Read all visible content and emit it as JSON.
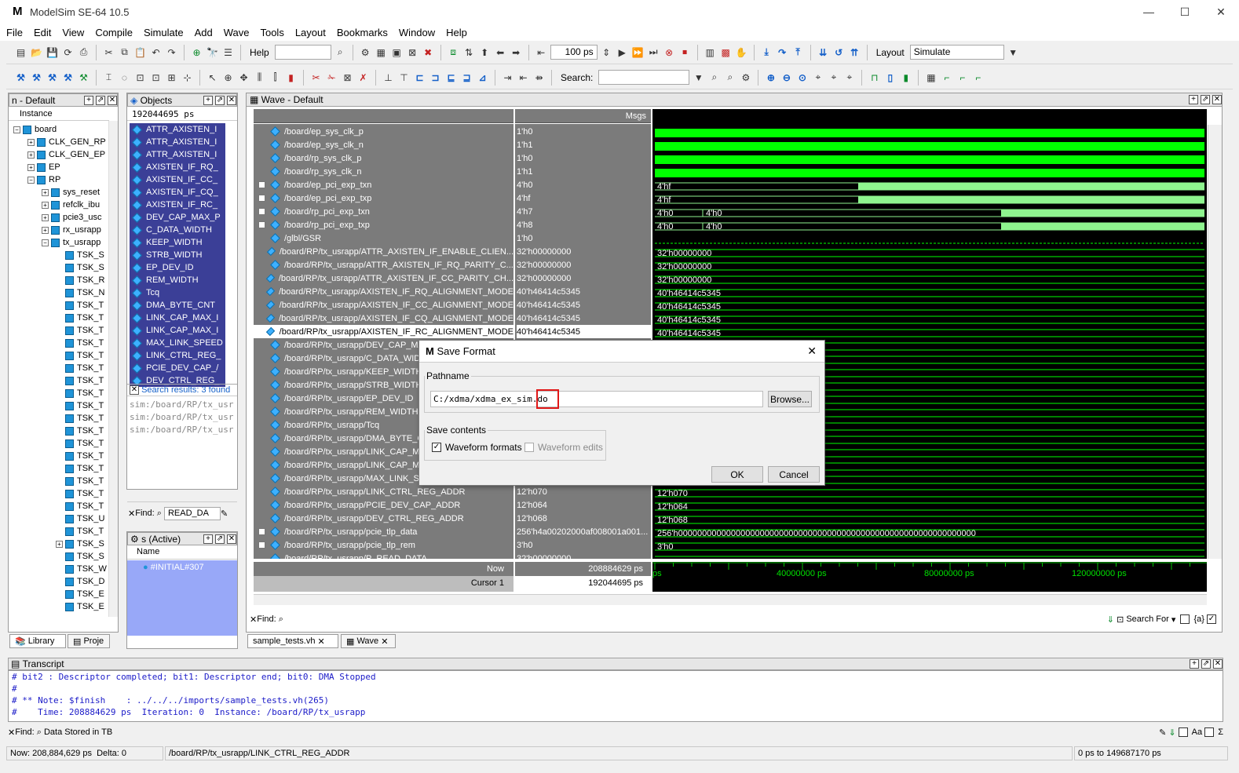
{
  "app": {
    "title": "ModelSim SE-64 10.5"
  },
  "menu": [
    "File",
    "Edit",
    "View",
    "Compile",
    "Simulate",
    "Add",
    "Wave",
    "Tools",
    "Layout",
    "Bookmarks",
    "Window",
    "Help"
  ],
  "toolbar1": {
    "help_label": "Help",
    "time_value": "100 ps",
    "layout_label": "Layout",
    "layout_value": "Simulate"
  },
  "toolbar2": {
    "search_label": "Search:"
  },
  "instance_panel": {
    "title": "n - Default",
    "column": "Instance",
    "rows": [
      {
        "label": "board",
        "level": 0,
        "exp": "-"
      },
      {
        "label": "CLK_GEN_RP",
        "level": 1,
        "exp": "+"
      },
      {
        "label": "CLK_GEN_EP",
        "level": 1,
        "exp": "+"
      },
      {
        "label": "EP",
        "level": 1,
        "exp": "+"
      },
      {
        "label": "RP",
        "level": 1,
        "exp": "-"
      },
      {
        "label": "sys_reset",
        "level": 2,
        "exp": "+"
      },
      {
        "label": "refclk_ibu",
        "level": 2,
        "exp": "+"
      },
      {
        "label": "pcie3_usc",
        "level": 2,
        "exp": "+"
      },
      {
        "label": "rx_usrapp",
        "level": 2,
        "exp": "+"
      },
      {
        "label": "tx_usrapp",
        "level": 2,
        "exp": "-"
      },
      {
        "label": "TSK_S",
        "level": 3,
        "exp": ""
      },
      {
        "label": "TSK_S",
        "level": 3,
        "exp": ""
      },
      {
        "label": "TSK_R",
        "level": 3,
        "exp": ""
      },
      {
        "label": "TSK_N",
        "level": 3,
        "exp": ""
      },
      {
        "label": "TSK_T",
        "level": 3,
        "exp": ""
      },
      {
        "label": "TSK_T",
        "level": 3,
        "exp": ""
      },
      {
        "label": "TSK_T",
        "level": 3,
        "exp": ""
      },
      {
        "label": "TSK_T",
        "level": 3,
        "exp": ""
      },
      {
        "label": "TSK_T",
        "level": 3,
        "exp": ""
      },
      {
        "label": "TSK_T",
        "level": 3,
        "exp": ""
      },
      {
        "label": "TSK_T",
        "level": 3,
        "exp": ""
      },
      {
        "label": "TSK_T",
        "level": 3,
        "exp": ""
      },
      {
        "label": "TSK_T",
        "level": 3,
        "exp": ""
      },
      {
        "label": "TSK_T",
        "level": 3,
        "exp": ""
      },
      {
        "label": "TSK_T",
        "level": 3,
        "exp": ""
      },
      {
        "label": "TSK_T",
        "level": 3,
        "exp": ""
      },
      {
        "label": "TSK_T",
        "level": 3,
        "exp": ""
      },
      {
        "label": "TSK_T",
        "level": 3,
        "exp": ""
      },
      {
        "label": "TSK_T",
        "level": 3,
        "exp": ""
      },
      {
        "label": "TSK_T",
        "level": 3,
        "exp": ""
      },
      {
        "label": "TSK_T",
        "level": 3,
        "exp": ""
      },
      {
        "label": "TSK_U",
        "level": 3,
        "exp": ""
      },
      {
        "label": "TSK_T",
        "level": 3,
        "exp": ""
      },
      {
        "label": "TSK_S",
        "level": 3,
        "exp": "+"
      },
      {
        "label": "TSK_S",
        "level": 3,
        "exp": ""
      },
      {
        "label": "TSK_W",
        "level": 3,
        "exp": ""
      },
      {
        "label": "TSK_D",
        "level": 3,
        "exp": ""
      },
      {
        "label": "TSK_E",
        "level": 3,
        "exp": ""
      },
      {
        "label": "TSK_E",
        "level": 3,
        "exp": ""
      }
    ],
    "tabs": [
      "Library",
      "Proje"
    ]
  },
  "objects_panel": {
    "title": "Objects",
    "time": "192044695 ps",
    "items": [
      "ATTR_AXISTEN_I",
      "ATTR_AXISTEN_I",
      "ATTR_AXISTEN_I",
      "AXISTEN_IF_RQ_",
      "AXISTEN_IF_CC_",
      "AXISTEN_IF_CQ_",
      "AXISTEN_IF_RC_",
      "DEV_CAP_MAX_P",
      "C_DATA_WIDTH",
      "KEEP_WIDTH",
      "STRB_WIDTH",
      "EP_DEV_ID",
      "REM_WIDTH",
      "Tcq",
      "DMA_BYTE_CNT",
      "LINK_CAP_MAX_I",
      "LINK_CAP_MAX_I",
      "MAX_LINK_SPEED",
      "LINK_CTRL_REG_",
      "PCIE_DEV_CAP_/",
      "DEV_CTRL_REG_"
    ],
    "search_results": "Search results: 3 found",
    "results": [
      "sim:/board/RP/tx_usr",
      "sim:/board/RP/tx_usr",
      "sim:/board/RP/tx_usr"
    ],
    "find_label": "Find:",
    "find_value": "READ_DA"
  },
  "process_panel": {
    "title": "s (Active)",
    "column": "Name",
    "item": "#INITIAL#307"
  },
  "wave": {
    "title": "Wave - Default",
    "msgs": "Msgs",
    "signals": [
      {
        "name": "/board/ep_sys_clk_p",
        "value": "1'h0",
        "exp": false
      },
      {
        "name": "/board/ep_sys_clk_n",
        "value": "1'h1",
        "exp": false
      },
      {
        "name": "/board/rp_sys_clk_p",
        "value": "1'h0",
        "exp": false
      },
      {
        "name": "/board/rp_sys_clk_n",
        "value": "1'h1",
        "exp": false
      },
      {
        "name": "/board/ep_pci_exp_txn",
        "value": "4'h0",
        "exp": true
      },
      {
        "name": "/board/ep_pci_exp_txp",
        "value": "4'hf",
        "exp": true
      },
      {
        "name": "/board/rp_pci_exp_txn",
        "value": "4'h7",
        "exp": true
      },
      {
        "name": "/board/rp_pci_exp_txp",
        "value": "4'h8",
        "exp": true
      },
      {
        "name": "/glbl/GSR",
        "value": "1'h0",
        "exp": false
      },
      {
        "name": "/board/RP/tx_usrapp/ATTR_AXISTEN_IF_ENABLE_CLIEN...",
        "value": "32'h00000000",
        "exp": false
      },
      {
        "name": "/board/RP/tx_usrapp/ATTR_AXISTEN_IF_RQ_PARITY_C...",
        "value": "32'h00000000",
        "exp": false
      },
      {
        "name": "/board/RP/tx_usrapp/ATTR_AXISTEN_IF_CC_PARITY_CH...",
        "value": "32'h00000000",
        "exp": false
      },
      {
        "name": "/board/RP/tx_usrapp/AXISTEN_IF_RQ_ALIGNMENT_MODE",
        "value": "40'h46414c5345",
        "exp": false
      },
      {
        "name": "/board/RP/tx_usrapp/AXISTEN_IF_CC_ALIGNMENT_MODE",
        "value": "40'h46414c5345",
        "exp": false
      },
      {
        "name": "/board/RP/tx_usrapp/AXISTEN_IF_CQ_ALIGNMENT_MODE",
        "value": "40'h46414c5345",
        "exp": false
      },
      {
        "name": "/board/RP/tx_usrapp/AXISTEN_IF_RC_ALIGNMENT_MODE",
        "value": "40'h46414c5345",
        "exp": false,
        "selected": true
      },
      {
        "name": "/board/RP/tx_usrapp/DEV_CAP_MA",
        "value": "",
        "exp": false
      },
      {
        "name": "/board/RP/tx_usrapp/C_DATA_WID",
        "value": "",
        "exp": false
      },
      {
        "name": "/board/RP/tx_usrapp/KEEP_WIDTH",
        "value": "",
        "exp": false
      },
      {
        "name": "/board/RP/tx_usrapp/STRB_WIDTH",
        "value": "",
        "exp": false
      },
      {
        "name": "/board/RP/tx_usrapp/EP_DEV_ID",
        "value": "",
        "exp": false
      },
      {
        "name": "/board/RP/tx_usrapp/REM_WIDTH",
        "value": "",
        "exp": false
      },
      {
        "name": "/board/RP/tx_usrapp/Tcq",
        "value": "",
        "exp": false
      },
      {
        "name": "/board/RP/tx_usrapp/DMA_BYTE_C",
        "value": "",
        "exp": false
      },
      {
        "name": "/board/RP/tx_usrapp/LINK_CAP_MA",
        "value": "",
        "exp": false
      },
      {
        "name": "/board/RP/tx_usrapp/LINK_CAP_MA",
        "value": "",
        "exp": false
      },
      {
        "name": "/board/RP/tx_usrapp/MAX_LINK_SP",
        "value": "",
        "exp": false
      },
      {
        "name": "/board/RP/tx_usrapp/LINK_CTRL_REG_ADDR",
        "value": "12'h070",
        "exp": false
      },
      {
        "name": "/board/RP/tx_usrapp/PCIE_DEV_CAP_ADDR",
        "value": "12'h064",
        "exp": false
      },
      {
        "name": "/board/RP/tx_usrapp/DEV_CTRL_REG_ADDR",
        "value": "12'h068",
        "exp": false
      },
      {
        "name": "/board/RP/tx_usrapp/pcie_tlp_data",
        "value": "256'h4a00202000af008001a001...",
        "exp": true
      },
      {
        "name": "/board/RP/tx_usrapp/pcie_tlp_rem",
        "value": "3'h0",
        "exp": true
      },
      {
        "name": "/board/RP/tx_usrapp/P_READ_DATA",
        "value": "32'h00000000",
        "exp": false
      }
    ],
    "waves": [
      {
        "kind": "clk"
      },
      {
        "kind": "clk"
      },
      {
        "kind": "clk"
      },
      {
        "kind": "clk"
      },
      {
        "kind": "bus",
        "labels": [
          "4'hf"
        ],
        "edge": 0.37
      },
      {
        "kind": "bus",
        "labels": [
          "4'hf"
        ],
        "edge": 0.37
      },
      {
        "kind": "bus",
        "labels": [
          "4'h0",
          "4'h0"
        ],
        "edge": 0.63
      },
      {
        "kind": "bus",
        "labels": [
          "4'h0",
          "4'h0"
        ],
        "edge": 0.63
      },
      {
        "kind": "gsr"
      },
      {
        "kind": "text",
        "labels": [
          "32'h00000000"
        ]
      },
      {
        "kind": "text",
        "labels": [
          "32'h00000000"
        ]
      },
      {
        "kind": "text",
        "labels": [
          "32'h00000000"
        ]
      },
      {
        "kind": "text",
        "labels": [
          "40'h46414c5345"
        ]
      },
      {
        "kind": "text",
        "labels": [
          "40'h46414c5345"
        ]
      },
      {
        "kind": "text",
        "labels": [
          "40'h46414c5345"
        ]
      },
      {
        "kind": "text",
        "labels": [
          "40'h46414c5345"
        ]
      },
      {
        "kind": "text",
        "labels": [
          ""
        ]
      },
      {
        "kind": "text",
        "labels": [
          ""
        ]
      },
      {
        "kind": "text",
        "labels": [
          ""
        ]
      },
      {
        "kind": "text",
        "labels": [
          ""
        ]
      },
      {
        "kind": "text",
        "labels": [
          ""
        ]
      },
      {
        "kind": "text",
        "labels": [
          ""
        ]
      },
      {
        "kind": "text",
        "labels": [
          ""
        ]
      },
      {
        "kind": "text",
        "labels": [
          ""
        ]
      },
      {
        "kind": "text",
        "labels": [
          ""
        ]
      },
      {
        "kind": "text",
        "labels": [
          ""
        ]
      },
      {
        "kind": "text",
        "labels": [
          ""
        ]
      },
      {
        "kind": "text",
        "labels": [
          "12'h070"
        ]
      },
      {
        "kind": "text",
        "labels": [
          "12'h064"
        ]
      },
      {
        "kind": "text",
        "labels": [
          "12'h068"
        ]
      },
      {
        "kind": "text",
        "labels": [
          "256'h00000000000000000000000000000000000000000000000000000000000000"
        ]
      },
      {
        "kind": "text",
        "labels": [
          "3'h0"
        ]
      },
      {
        "kind": "text",
        "labels": [
          ""
        ]
      }
    ],
    "now_label": "Now",
    "now_value": "208884629 ps",
    "cursor_label": "Cursor 1",
    "cursor_value": "192044695 ps",
    "ticks": [
      "ps",
      "40000000 ps",
      "80000000 ps",
      "120000000 ps"
    ],
    "find_label": "Find:",
    "search_for": "Search For",
    "tabs": [
      "sample_tests.vh",
      "Wave"
    ]
  },
  "dialog": {
    "title": "Save Format",
    "pathname_label": "Pathname",
    "path_value": "C:/xdma/xdma_ex_sim.do",
    "browse": "Browse...",
    "save_contents": "Save contents",
    "wf_formats": "Waveform formats",
    "wf_edits": "Waveform edits",
    "ok": "OK",
    "cancel": "Cancel",
    "highlight_color": "#e01818"
  },
  "transcript": {
    "title": "Transcript",
    "lines": [
      "# bit2 : Descriptor completed; bit1: Descriptor end; bit0: DMA Stopped",
      "#",
      "# ** Note: $finish    : ../../../imports/sample_tests.vh(265)",
      "#    Time: 208884629 ps  Iteration: 0  Instance: /board/RP/tx_usrapp"
    ],
    "find_label": "Find:",
    "find_value": "Data Stored in TB"
  },
  "status": {
    "now": "Now: 208,884,629 ps",
    "delta": "Delta: 0",
    "path": "/board/RP/tx_usrapp/LINK_CTRL_REG_ADDR",
    "range": "0 ps to 149687170 ps"
  },
  "colors": {
    "clock_green": "#00ff00",
    "bus_green": "#8ff58f",
    "selected_blue": "#3b3f97"
  }
}
